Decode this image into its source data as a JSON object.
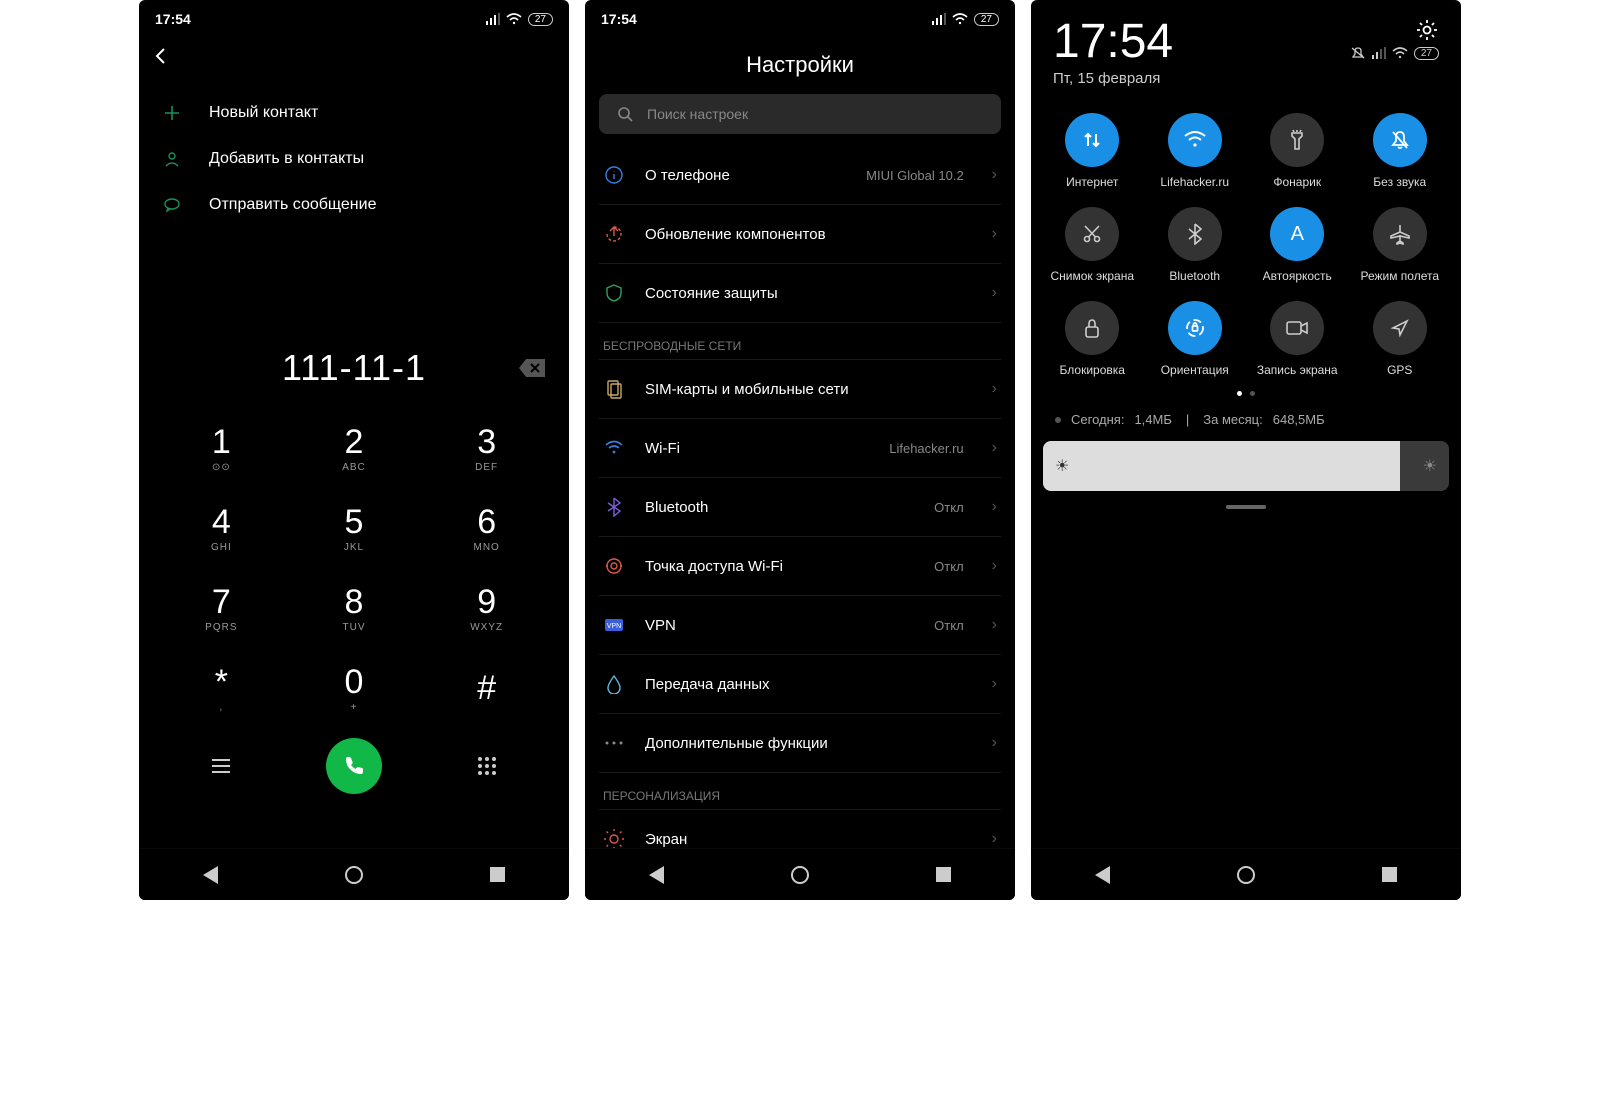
{
  "statusbar": {
    "time": "17:54",
    "battery": "27"
  },
  "dialer": {
    "actions": {
      "new_contact": "Новый контакт",
      "add_contact": "Добавить в контакты",
      "send_message": "Отправить сообщение"
    },
    "number": "111-11-1",
    "keys": [
      {
        "d": "1",
        "s": "⊙⊙"
      },
      {
        "d": "2",
        "s": "ABC"
      },
      {
        "d": "3",
        "s": "DEF"
      },
      {
        "d": "4",
        "s": "GHI"
      },
      {
        "d": "5",
        "s": "JKL"
      },
      {
        "d": "6",
        "s": "MNO"
      },
      {
        "d": "7",
        "s": "PQRS"
      },
      {
        "d": "8",
        "s": "TUV"
      },
      {
        "d": "9",
        "s": "WXYZ"
      },
      {
        "d": "*",
        "s": ","
      },
      {
        "d": "0",
        "s": "+"
      },
      {
        "d": "#",
        "s": ""
      }
    ]
  },
  "settings": {
    "title": "Настройки",
    "search_placeholder": "Поиск настроек",
    "sections": {
      "wireless": "БЕСПРОВОДНЫЕ СЕТИ",
      "personalization": "ПЕРСОНАЛИЗАЦИЯ"
    },
    "rows": {
      "about": {
        "label": "О телефоне",
        "value": "MIUI Global 10.2"
      },
      "update": {
        "label": "Обновление компонентов",
        "value": ""
      },
      "security": {
        "label": "Состояние защиты",
        "value": ""
      },
      "sim": {
        "label": "SIM-карты и мобильные сети",
        "value": ""
      },
      "wifi": {
        "label": "Wi-Fi",
        "value": "Lifehacker.ru"
      },
      "bluetooth": {
        "label": "Bluetooth",
        "value": "Откл"
      },
      "hotspot": {
        "label": "Точка доступа Wi-Fi",
        "value": "Откл"
      },
      "vpn": {
        "label": "VPN",
        "value": "Откл"
      },
      "data": {
        "label": "Передача данных",
        "value": ""
      },
      "more": {
        "label": "Дополнительные функции",
        "value": ""
      },
      "display": {
        "label": "Экран",
        "value": ""
      }
    }
  },
  "shade": {
    "time": "17:54",
    "date": "Пт, 15 февраля",
    "battery": "27",
    "tiles": [
      {
        "id": "internet",
        "label": "Интернет",
        "active": true,
        "icon": "data"
      },
      {
        "id": "wifi",
        "label": "Lifehacker.ru",
        "active": true,
        "icon": "wifi"
      },
      {
        "id": "flashlight",
        "label": "Фонарик",
        "active": false,
        "icon": "flash"
      },
      {
        "id": "mute",
        "label": "Без звука",
        "active": true,
        "icon": "mute"
      },
      {
        "id": "screenshot",
        "label": "Снимок экрана",
        "active": false,
        "icon": "scissors"
      },
      {
        "id": "bluetooth",
        "label": "Bluetooth",
        "active": false,
        "icon": "bt"
      },
      {
        "id": "autobright",
        "label": "Автояркость",
        "active": true,
        "icon": "A"
      },
      {
        "id": "airplane",
        "label": "Режим полета",
        "active": false,
        "icon": "plane"
      },
      {
        "id": "lock",
        "label": "Блокировка",
        "active": false,
        "icon": "lock"
      },
      {
        "id": "orientation",
        "label": "Ориентация",
        "active": true,
        "icon": "rotate"
      },
      {
        "id": "screenrec",
        "label": "Запись экрана",
        "active": false,
        "icon": "video"
      },
      {
        "id": "gps",
        "label": "GPS",
        "active": false,
        "icon": "nav"
      }
    ],
    "usage": {
      "today_label": "Сегодня:",
      "today": "1,4МБ",
      "sep": "|",
      "month_label": "За месяц:",
      "month": "648,5МБ"
    }
  }
}
